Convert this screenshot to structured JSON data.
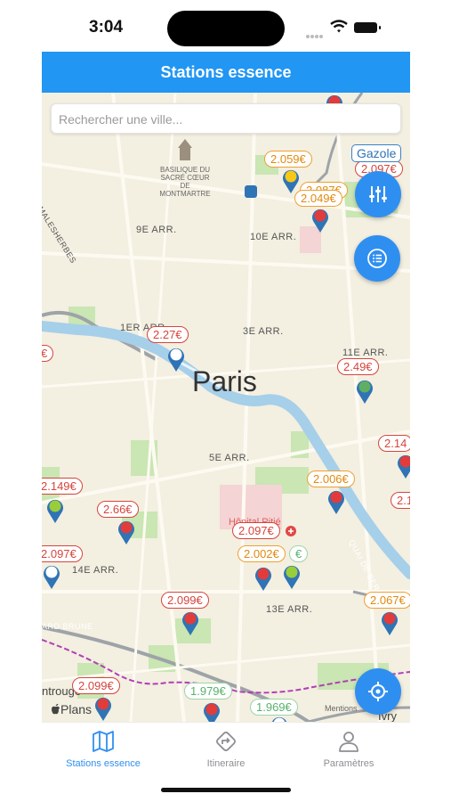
{
  "status_bar": {
    "time": "3:04"
  },
  "header": {
    "title": "Stations essence"
  },
  "search": {
    "placeholder": "Rechercher une ville..."
  },
  "fuel_filter": {
    "label": "Gazole"
  },
  "map": {
    "city": "Paris",
    "landmark": "BASILIQUE DU SACRÉ CŒUR DE MONTMARTRE",
    "districts": [
      "9E ARR.",
      "10E ARR.",
      "1ER ARR.",
      "3E ARR.",
      "11E ARR.",
      "5E ARR.",
      "14E ARR.",
      "13E ARR."
    ],
    "hospital": "Hôpital Pitié",
    "street_labels": [
      "MALESHERBES",
      "QUAI DE BERCY",
      "ARD BRUNE"
    ],
    "place_labels": [
      "ntrouge",
      "Ivry",
      "Mentions"
    ],
    "attribution": "Plans",
    "prices": [
      {
        "value": "2.059€",
        "style": "orange"
      },
      {
        "value": "2.097€",
        "style": "red"
      },
      {
        "value": "2.087€",
        "style": "orange"
      },
      {
        "value": "2.049€",
        "style": "orange"
      },
      {
        "value": "2.27€",
        "style": "red"
      },
      {
        "value": "€",
        "style": "red"
      },
      {
        "value": "2.49€",
        "style": "red"
      },
      {
        "value": "2.14",
        "style": "red"
      },
      {
        "value": "2.006€",
        "style": "orange"
      },
      {
        "value": "2.149€",
        "style": "red"
      },
      {
        "value": "2.66€",
        "style": "red"
      },
      {
        "value": "2.1",
        "style": "red"
      },
      {
        "value": "2.097€",
        "style": "red"
      },
      {
        "value": "2.097€",
        "style": "red"
      },
      {
        "value": "2.002€",
        "style": "orange"
      },
      {
        "value": "€",
        "style": "green"
      },
      {
        "value": "2.099€",
        "style": "red"
      },
      {
        "value": "2.067€",
        "style": "orange"
      },
      {
        "value": "2.099€",
        "style": "red"
      },
      {
        "value": "1.979€",
        "style": "green"
      },
      {
        "value": "1.969€",
        "style": "green"
      }
    ]
  },
  "tabs": [
    {
      "label": "Stations essence",
      "icon": "map-icon",
      "active": true
    },
    {
      "label": "Itineraire",
      "icon": "directions-icon",
      "active": false
    },
    {
      "label": "Paramètres",
      "icon": "person-icon",
      "active": false
    }
  ],
  "colors": {
    "primary": "#2196f3",
    "price_red": "#d6453d",
    "price_orange": "#f0a030",
    "price_green": "#58b26b"
  }
}
